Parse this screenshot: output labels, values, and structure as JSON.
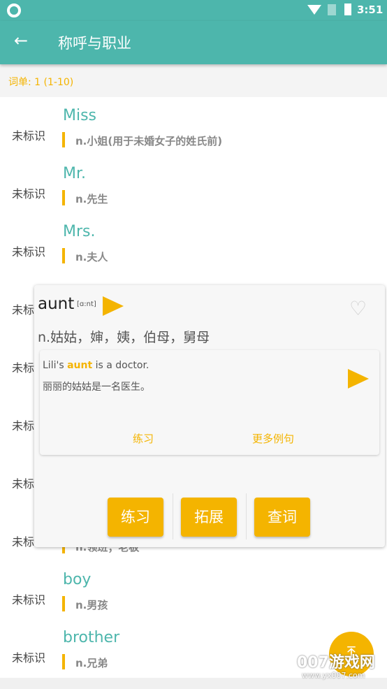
{
  "status": {
    "time": "3:51"
  },
  "header": {
    "title": "称呼与职业"
  },
  "subheader": {
    "text": "词单: 1 (1-10)"
  },
  "list": [
    {
      "label": "未标识",
      "word": "Miss",
      "meaning": "n.小姐(用于未婚女子的姓氏前)"
    },
    {
      "label": "未标识",
      "word": "Mr.",
      "meaning": "n.先生"
    },
    {
      "label": "未标识",
      "word": "Mrs.",
      "meaning": "n.夫人"
    },
    {
      "label": "未标识",
      "word": "",
      "meaning": ""
    },
    {
      "label": "未标识",
      "word": "",
      "meaning": ""
    },
    {
      "label": "未标识",
      "word": "",
      "meaning": ""
    },
    {
      "label": "未标识",
      "word": "",
      "meaning": ""
    },
    {
      "label": "未标识",
      "word": "",
      "meaning": "n.领班；老板"
    },
    {
      "label": "未标识",
      "word": "boy",
      "meaning": "n.男孩"
    },
    {
      "label": "未标识",
      "word": "brother",
      "meaning": "n.兄弟"
    }
  ],
  "popup": {
    "word": "aunt",
    "phonetic": "[ɑ:nt]",
    "definition": "n.姑姑，婶，姨，伯母，舅母",
    "example": {
      "before": "Lili's ",
      "highlight": "aunt",
      "after": " is a doctor.",
      "translation": "丽丽的姑姑是一名医生。",
      "practice": "练习",
      "more": "更多例句"
    },
    "buttons": [
      "练习",
      "拓展",
      "查词"
    ]
  },
  "watermark": {
    "line1": "007游戏网",
    "line2": "www.yx007.com"
  },
  "colors": {
    "primary": "#4db6ac",
    "accent": "#f4b400"
  }
}
